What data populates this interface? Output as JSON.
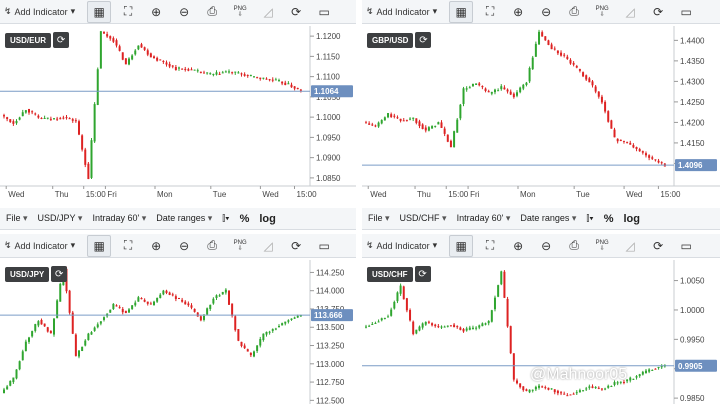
{
  "toolbar": {
    "add_indicator": "Add Indicator",
    "png": "PNG"
  },
  "subbar": {
    "file": "File",
    "interval": "Intraday 60'",
    "date_ranges": "Date ranges",
    "percent": "%",
    "log": "log"
  },
  "colors": {
    "up": "#2fa52f",
    "down": "#dd2222",
    "price_line": "#7a9cc6",
    "label_bg": "#6d8fbf"
  },
  "watermark": "@Mahnoor05",
  "panels": [
    {
      "symbol": "USD/EUR",
      "price_label": "1.1064",
      "y_ticks": [
        "1.1200",
        "1.1150",
        "1.1100",
        "1.1050",
        "1.1000",
        "1.0950",
        "1.0900",
        "1.0850"
      ],
      "x_ticks": [
        "Wed",
        "Thu",
        "15:00",
        "Fri",
        "Mon",
        "Tue",
        "Wed",
        "15:00"
      ]
    },
    {
      "symbol": "GBP/USD",
      "price_label": "1.4096",
      "y_ticks": [
        "1.4400",
        "1.4350",
        "1.4300",
        "1.4250",
        "1.4200",
        "1.4150",
        "1.4100"
      ],
      "x_ticks": [
        "Wed",
        "Thu",
        "15:00",
        "Fri",
        "Mon",
        "Tue",
        "Wed",
        "15:00"
      ]
    },
    {
      "symbol": "USD/JPY",
      "price_label": "113.666",
      "y_ticks": [
        "114.250",
        "114.000",
        "113.750",
        "113.500",
        "113.250",
        "113.000",
        "112.750",
        "112.500"
      ],
      "x_ticks": []
    },
    {
      "symbol": "USD/CHF",
      "price_label": "0.9905",
      "y_ticks": [
        "1.0050",
        "1.0000",
        "0.9950",
        "0.9900",
        "0.9850"
      ],
      "x_ticks": []
    }
  ],
  "chart_data": [
    {
      "type": "line",
      "title": "USD/EUR",
      "ylim": [
        1.083,
        1.1225
      ],
      "x": [
        "Wed",
        "Thu",
        "15:00",
        "Fri",
        "Mon",
        "Tue",
        "Wed",
        "15:00"
      ],
      "values": [
        1.1005,
        1.0985,
        1.102,
        1.0998,
        1.0995,
        1.1,
        1.099,
        1.085,
        1.121,
        1.119,
        1.113,
        1.118,
        1.115,
        1.1135,
        1.112,
        1.1118,
        1.111,
        1.1105,
        1.1112,
        1.1108,
        1.11,
        1.1095,
        1.109,
        1.108,
        1.1064
      ],
      "last": 1.1064
    },
    {
      "type": "line",
      "title": "GBP/USD",
      "ylim": [
        1.4045,
        1.4435
      ],
      "x": [
        "Wed",
        "Thu",
        "15:00",
        "Fri",
        "Mon",
        "Tue",
        "Wed",
        "15:00"
      ],
      "values": [
        1.42,
        1.419,
        1.422,
        1.4205,
        1.421,
        1.418,
        1.42,
        1.414,
        1.428,
        1.4295,
        1.427,
        1.4285,
        1.4265,
        1.43,
        1.442,
        1.438,
        1.436,
        1.433,
        1.43,
        1.425,
        1.416,
        1.415,
        1.413,
        1.411,
        1.4096
      ],
      "last": 1.4096
    },
    {
      "type": "line",
      "title": "USD/JPY",
      "ylim": [
        112.45,
        114.42
      ],
      "values": [
        112.6,
        112.8,
        113.3,
        113.6,
        113.4,
        114.3,
        113.1,
        113.4,
        113.6,
        113.8,
        113.7,
        113.9,
        113.8,
        114.0,
        113.9,
        113.8,
        113.6,
        113.9,
        114.0,
        113.3,
        113.1,
        113.4,
        113.5,
        113.6,
        113.666
      ],
      "last": 113.666
    },
    {
      "type": "line",
      "title": "USD/CHF",
      "ylim": [
        0.984,
        1.0085
      ],
      "values": [
        0.997,
        0.998,
        0.999,
        1.004,
        0.996,
        0.998,
        0.997,
        0.9975,
        0.9965,
        0.997,
        0.998,
        1.0065,
        0.988,
        0.986,
        0.987,
        0.9865,
        0.9855,
        0.986,
        0.987,
        0.9865,
        0.9875,
        0.988,
        0.989,
        0.99,
        0.9905
      ],
      "last": 0.9905
    }
  ]
}
